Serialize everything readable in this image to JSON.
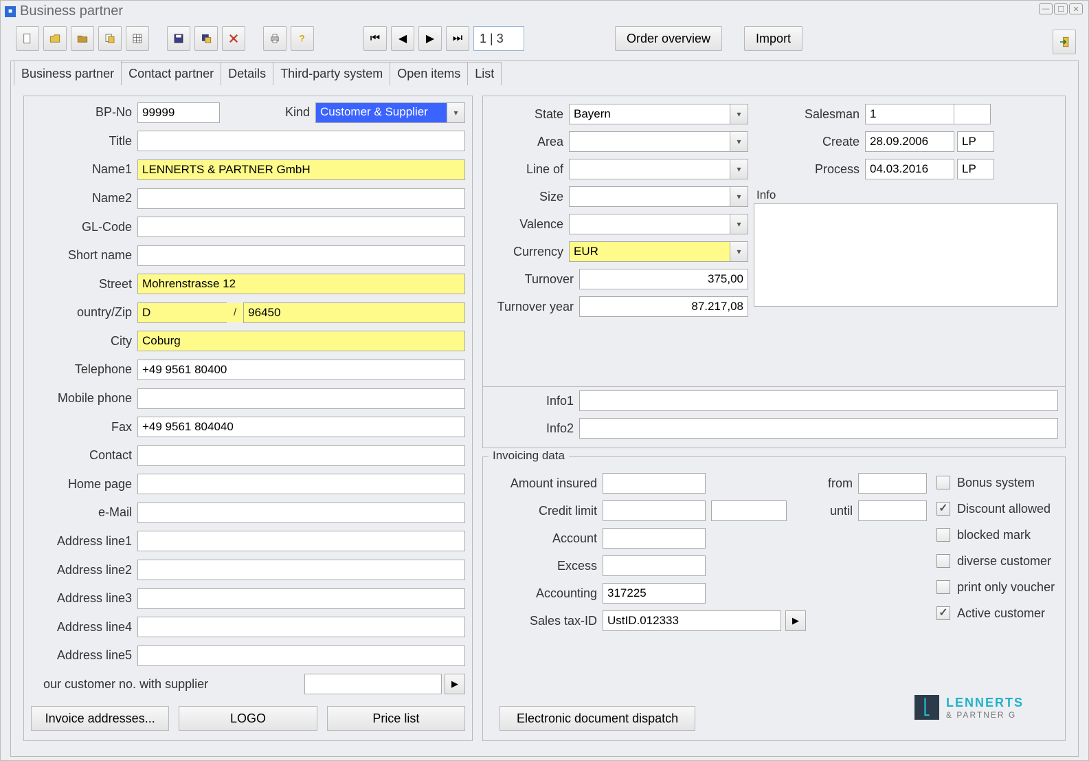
{
  "window": {
    "title": "Business partner",
    "pager": "1 | 3",
    "buttons": {
      "order_overview": "Order overview",
      "import": "Import"
    }
  },
  "tabs": [
    "Business partner",
    "Contact partner",
    "Details",
    "Third-party system",
    "Open items",
    "List"
  ],
  "left": {
    "bp_no_label": "BP-No",
    "bp_no": "99999",
    "kind_label": "Kind",
    "kind_value": "Customer & Supplier",
    "title_label": "Title",
    "title": "",
    "name1_label": "Name1",
    "name1": "LENNERTS & PARTNER GmbH",
    "name2_label": "Name2",
    "name2": "",
    "glcode_label": "GL-Code",
    "glcode": "",
    "shortname_label": "Short name",
    "shortname": "",
    "street_label": "Street",
    "street": "Mohrenstrasse 12",
    "countryzip_label": "ountry/Zip",
    "country": "D",
    "zipsep": "/",
    "zip": "96450",
    "city_label": "City",
    "city": "Coburg",
    "telephone_label": "Telephone",
    "telephone": "+49 9561 80400",
    "mobile_label": "Mobile phone",
    "mobile": "",
    "fax_label": "Fax",
    "fax": "+49 9561 804040",
    "contact_label": "Contact",
    "contact": "",
    "homepage_label": "Home page",
    "homepage": "",
    "email_label": "e-Mail",
    "email": "",
    "addr1_label": "Address line1",
    "addr1": "",
    "addr2_label": "Address line2",
    "addr2": "",
    "addr3_label": "Address line3",
    "addr3": "",
    "addr4_label": "Address line4",
    "addr4": "",
    "addr5_label": "Address line5",
    "addr5": "",
    "ourcust_label": "our customer no. with supplier",
    "ourcust": "",
    "buttons": {
      "invoice_addresses": "Invoice addresses...",
      "logo": "LOGO",
      "price_list": "Price list"
    }
  },
  "right": {
    "state_label": "State",
    "state": "Bayern",
    "area_label": "Area",
    "area": "",
    "lineof_label": "Line of",
    "lineof": "",
    "size_label": "Size",
    "size": "",
    "valence_label": "Valence",
    "valence": "",
    "currency_label": "Currency",
    "currency": "EUR",
    "turnover_label": "Turnover",
    "turnover": "375,00",
    "turnover_year_label": "Turnover year",
    "turnover_year": "87.217,08",
    "info1_label": "Info1",
    "info1": "",
    "info2_label": "Info2",
    "info2": "",
    "salesman_label": "Salesman",
    "salesman": "1",
    "create_label": "Create",
    "create_date": "28.09.2006",
    "create_user": "LP",
    "process_label": "Process",
    "process_date": "04.03.2016",
    "process_user": "LP",
    "info_label": "Info",
    "info_text": ""
  },
  "invoicing": {
    "legend": "Invoicing data",
    "amount_insured_label": "Amount insured",
    "amount_insured": "",
    "credit_limit_label": "Credit limit",
    "credit_limit": "",
    "credit_limit_sel": "",
    "account_label": "Account",
    "account": "",
    "excess_label": "Excess",
    "excess": "",
    "accounting_label": "Accounting",
    "accounting": "317225",
    "salestax_label": "Sales tax-ID",
    "salestax": "UstID.012333",
    "from_label": "from",
    "from": "",
    "until_label": "until",
    "until": "",
    "checks": {
      "bonus_system": {
        "label": "Bonus system",
        "checked": false
      },
      "discount_allowed": {
        "label": "Discount allowed",
        "checked": true
      },
      "blocked_mark": {
        "label": "blocked mark",
        "checked": false
      },
      "diverse_customer": {
        "label": "diverse customer",
        "checked": false
      },
      "print_only_voucher": {
        "label": "print only voucher",
        "checked": false
      },
      "active_customer": {
        "label": "Active customer",
        "checked": true
      }
    },
    "edd_button": "Electronic document dispatch",
    "logo_line1": "LENNERTS",
    "logo_line2": "& PARTNER G"
  }
}
